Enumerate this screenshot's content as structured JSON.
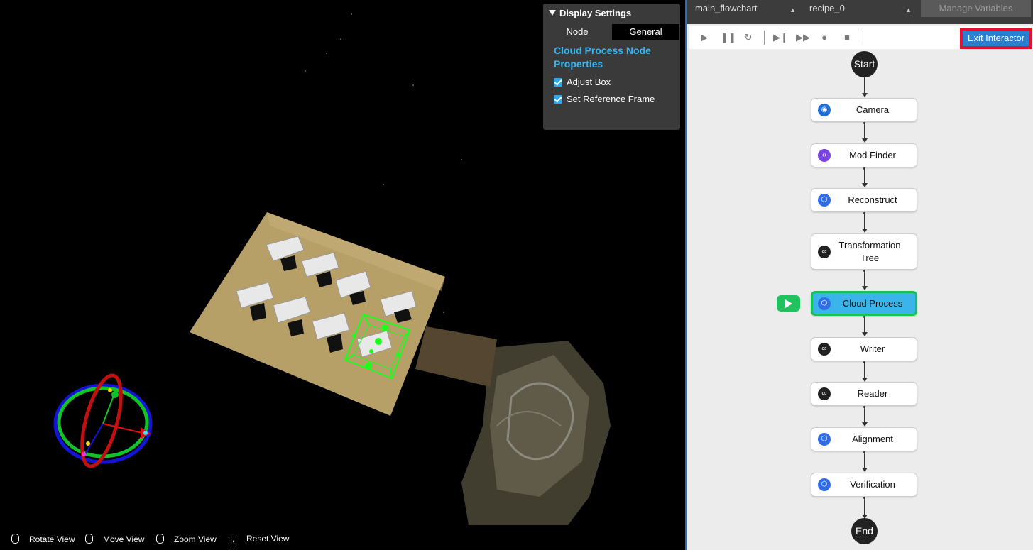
{
  "viewport": {
    "display_settings": {
      "title": "Display Settings",
      "tabs": [
        "Node",
        "General"
      ],
      "section_title": "Cloud Process Node Properties",
      "checkboxes": [
        {
          "label": "Adjust Box",
          "checked": true
        },
        {
          "label": "Set Reference Frame",
          "checked": true
        }
      ]
    },
    "hints": [
      {
        "key": "mouse-left",
        "label": "Rotate View"
      },
      {
        "key": "mouse-right",
        "label": "Move View"
      },
      {
        "key": "mouse-wheel",
        "label": "Zoom View"
      },
      {
        "key": "R",
        "label": "Reset View"
      }
    ]
  },
  "flowchart_panel": {
    "flowchart_select": "main_flowchart",
    "recipe_select": "recipe_0",
    "manage_variables": "Manage Variables",
    "exit_interactor": "Exit Interactor",
    "start": "Start",
    "end": "End",
    "nodes": [
      {
        "label": "Camera",
        "icon": "camera-icon",
        "color": "#1e6fd9"
      },
      {
        "label": "Mod Finder",
        "icon": "code-icon",
        "color": "#7a45e0"
      },
      {
        "label": "Reconstruct",
        "icon": "cube-icon",
        "color": "#2f6ee6"
      },
      {
        "label": "Transformation Tree",
        "icon": "link-icon",
        "color": "#222222"
      },
      {
        "label": "Cloud Process",
        "icon": "cube-icon",
        "color": "#2f6ee6",
        "active": true
      },
      {
        "label": "Writer",
        "icon": "link-icon",
        "color": "#222222"
      },
      {
        "label": "Reader",
        "icon": "link-icon",
        "color": "#222222"
      },
      {
        "label": "Alignment",
        "icon": "cube-icon",
        "color": "#2f6ee6"
      },
      {
        "label": "Verification",
        "icon": "cube-icon",
        "color": "#2f6ee6"
      }
    ]
  },
  "colors": {
    "accent": "#35b6f0",
    "active_node": "#3ab4ea",
    "active_border": "#17c25a",
    "exit_highlight": "#e3112d"
  }
}
